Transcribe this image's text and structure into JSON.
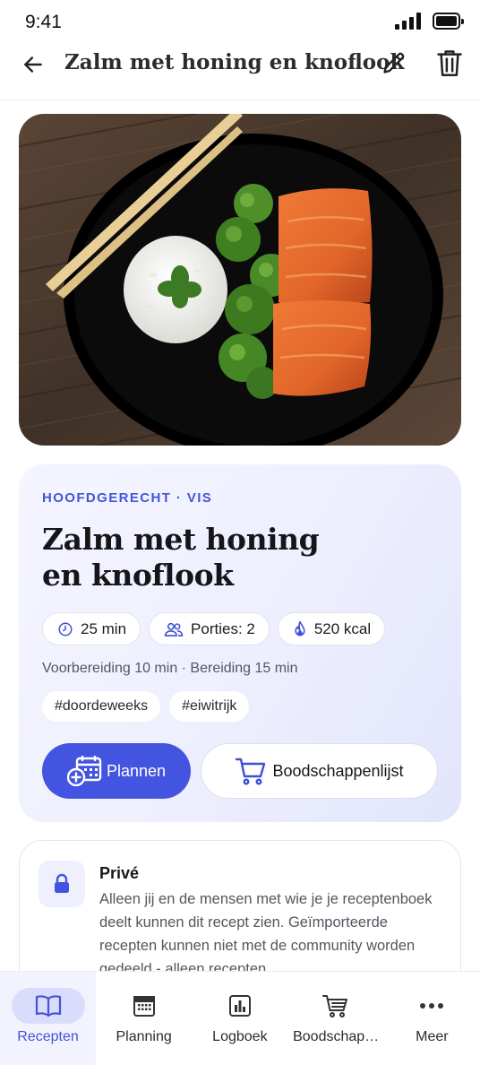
{
  "status_bar": {
    "time": "9:41"
  },
  "header": {
    "title": "Zalm met honing en knoflook"
  },
  "info": {
    "category": "HOOFDGERECHT · VIS",
    "title": "Zalm met honing en knoflook",
    "chips": [
      {
        "icon": "clock-icon",
        "label": "25 min"
      },
      {
        "icon": "people-icon",
        "label": "Porties: 2"
      },
      {
        "icon": "flame-icon",
        "label": "520 kcal"
      }
    ],
    "prep": "Voorbereiding 10 min · Bereiding 15 min",
    "tags": [
      "#doordeweeks",
      "#eiwitrijk"
    ],
    "plan_label": "Plannen",
    "shop_label": "Boodschappenlijst"
  },
  "privacy": {
    "title": "Privé",
    "text": "Alleen jij en de mensen met wie je je receptenboek deelt kunnen dit recept zien. Geïmporteerde recepten kunnen niet met de community worden gedeeld - alleen recepten"
  },
  "tabbar": {
    "items": [
      {
        "label": "Recepten",
        "icon": "book-icon",
        "active": true
      },
      {
        "label": "Planning",
        "icon": "calendar-icon",
        "active": false
      },
      {
        "label": "Logboek",
        "icon": "chart-icon",
        "active": false
      },
      {
        "label": "Boodschap…",
        "icon": "cart-icon",
        "active": false
      },
      {
        "label": "Meer",
        "icon": "more-icon",
        "active": false
      }
    ]
  },
  "colors": {
    "accent": "#4355e0",
    "card_bg": "#eef0fe",
    "active_tab_bg": "#d9ddfb"
  }
}
